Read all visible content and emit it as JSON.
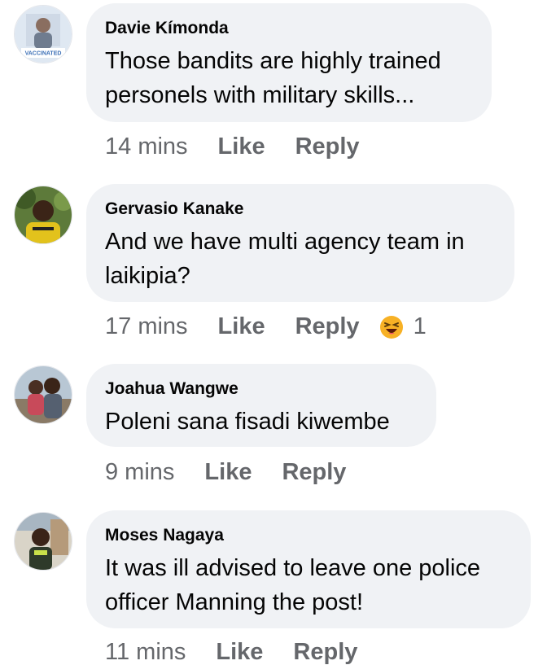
{
  "comments": [
    {
      "author": "Davie Kímonda",
      "text_lines": [
        "Those bandits are highly trained",
        "personels with military skills..."
      ],
      "time": "14 mins",
      "like_label": "Like",
      "reply_label": "Reply",
      "avatar_badge": "VACCINATED"
    },
    {
      "author": "Gervasio Kanake",
      "text_lines": [
        "And we have multi agency team in",
        "laikipia?"
      ],
      "time": "17 mins",
      "like_label": "Like",
      "reply_label": "Reply",
      "reaction": {
        "icon": "laughing-emoji-icon",
        "count": "1"
      }
    },
    {
      "author": "Joahua Wangwe",
      "text_lines": [
        "Poleni sana fisadi kiwembe"
      ],
      "time": "9 mins",
      "like_label": "Like",
      "reply_label": "Reply"
    },
    {
      "author": "Moses Nagaya",
      "text_lines": [
        "It was ill advised to leave one police",
        "officer Manning the post!"
      ],
      "time": "11 mins",
      "like_label": "Like",
      "reply_label": "Reply"
    }
  ],
  "colors": {
    "bubble": "#f0f2f5",
    "text": "#050505",
    "meta": "#65676b",
    "emoji": "#f7b125"
  }
}
